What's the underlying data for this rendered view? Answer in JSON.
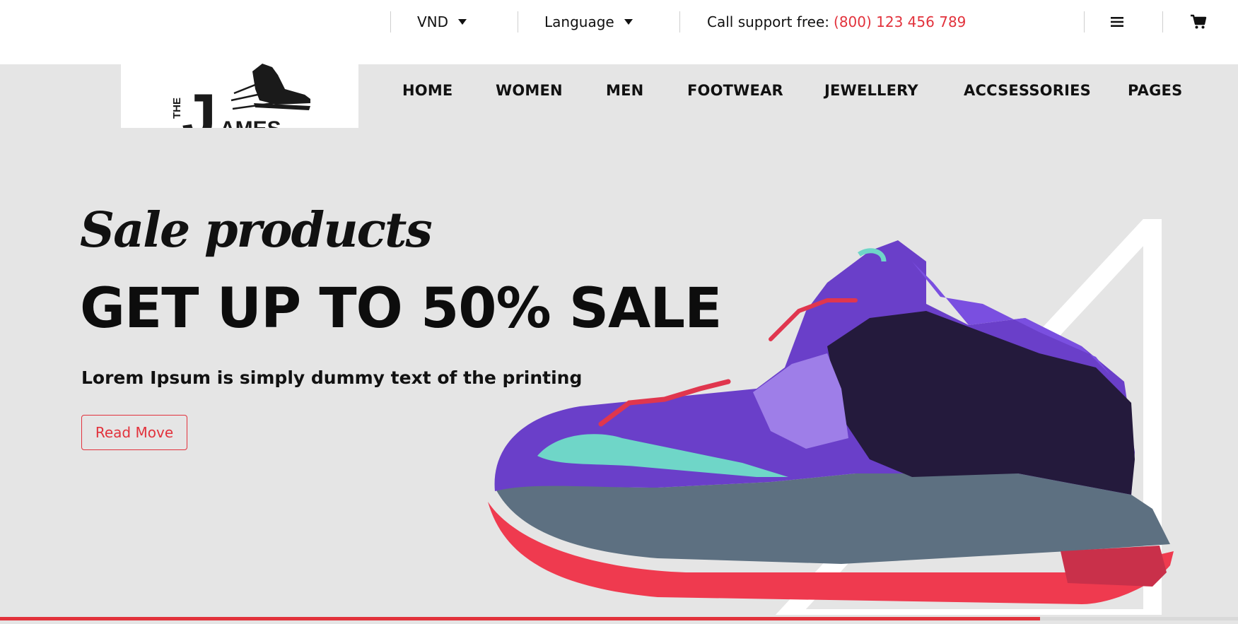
{
  "topbar": {
    "currency": "VND",
    "language": "Language",
    "support_label": "Call support free:",
    "support_phone": "(800) 123 456 789",
    "menu_icon": "hamburger-icon",
    "cart_icon": "cart-icon"
  },
  "logo": {
    "the": "THE",
    "j": "J",
    "ames": "AMES"
  },
  "nav": {
    "items": [
      "HOME",
      "WOMEN",
      "MEN",
      "FOOTWEAR",
      "JEWELLERY",
      "ACCSESSORIES",
      "PAGES"
    ]
  },
  "hero": {
    "script_heading": "Sale products",
    "title": "GET UP TO 50% SALE",
    "subtitle": "Lorem Ipsum is simply dummy text of the printing",
    "button_label": "Read Move",
    "image_icon": "sneaker-image"
  },
  "slider": {
    "progress_fraction": 0.84
  },
  "colors": {
    "accent": "#e2323c",
    "background": "#e5e5e5",
    "header": "#ffffff"
  }
}
